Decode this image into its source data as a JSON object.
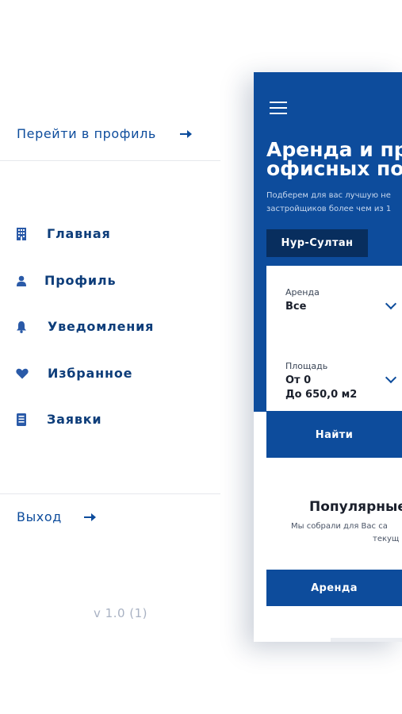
{
  "drawer": {
    "profile_link": "Перейти в профиль",
    "menu": [
      {
        "label": "Главная",
        "icon": "building-icon"
      },
      {
        "label": "Профиль",
        "icon": "user-icon"
      },
      {
        "label": "Уведомления",
        "icon": "bell-icon"
      },
      {
        "label": "Избранное",
        "icon": "heart-icon"
      },
      {
        "label": "Заявки",
        "icon": "document-icon"
      }
    ],
    "logout": "Выход",
    "version": "v 1.0 (1)"
  },
  "app": {
    "hero": {
      "title_line1": "Аренда и пр",
      "title_line2": "офисных по",
      "subtitle_line1": "Подберем для вас лучшую не",
      "subtitle_line2": "застройщиков более чем из 1"
    },
    "city_button": "Нур-Султан",
    "filters": {
      "rent_label": "Аренда",
      "rent_value": "Все",
      "area_label": "Площадь",
      "area_from": "От 0",
      "area_to": "До 650,0  м2"
    },
    "find_button": "Найти",
    "popular": {
      "title": "Популярные",
      "subtitle_line1": "Мы собрали для Вас са",
      "subtitle_line2": "текущ"
    },
    "rent_button": "Аренда"
  },
  "colors": {
    "primary": "#0d4c9c",
    "dark_button": "#082e5e",
    "menu_text": "#0d3d7a",
    "version_text": "#a9b2c3"
  }
}
